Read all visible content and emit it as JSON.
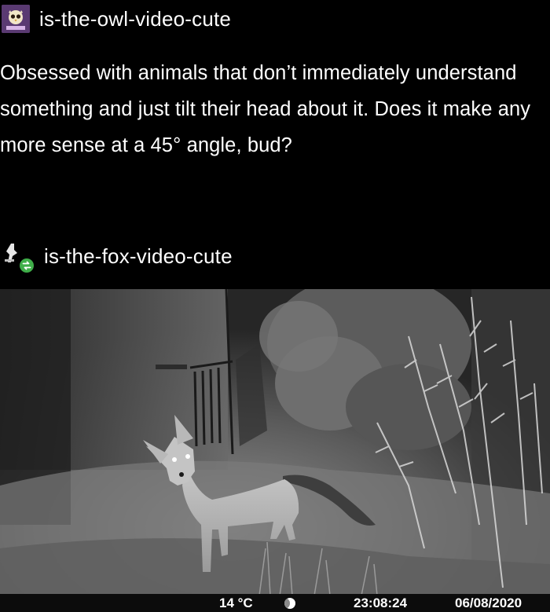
{
  "posts": [
    {
      "username": "is-the-owl-video-cute",
      "avatar_icon": "owl-avatar-icon",
      "body": "Obsessed with animals that don’t immediately understand something and just tilt their head about it. Does it make any more sense at a 45° angle, bud?"
    },
    {
      "username": "is-the-fox-video-cute",
      "avatar_icon": "fox-avatar-icon",
      "reblog_badge_icon": "reblog-icon"
    }
  ],
  "photo": {
    "subject": "fox-photo",
    "camera": {
      "temperature": "14 °C",
      "moon_icon": "moon-phase-icon",
      "time": "23:08:24",
      "date": "06/08/2020"
    }
  },
  "colors": {
    "background": "#000000",
    "text": "#ffffff",
    "owl_avatar": "#6a4a84",
    "reblog_badge": "#3fae49"
  }
}
